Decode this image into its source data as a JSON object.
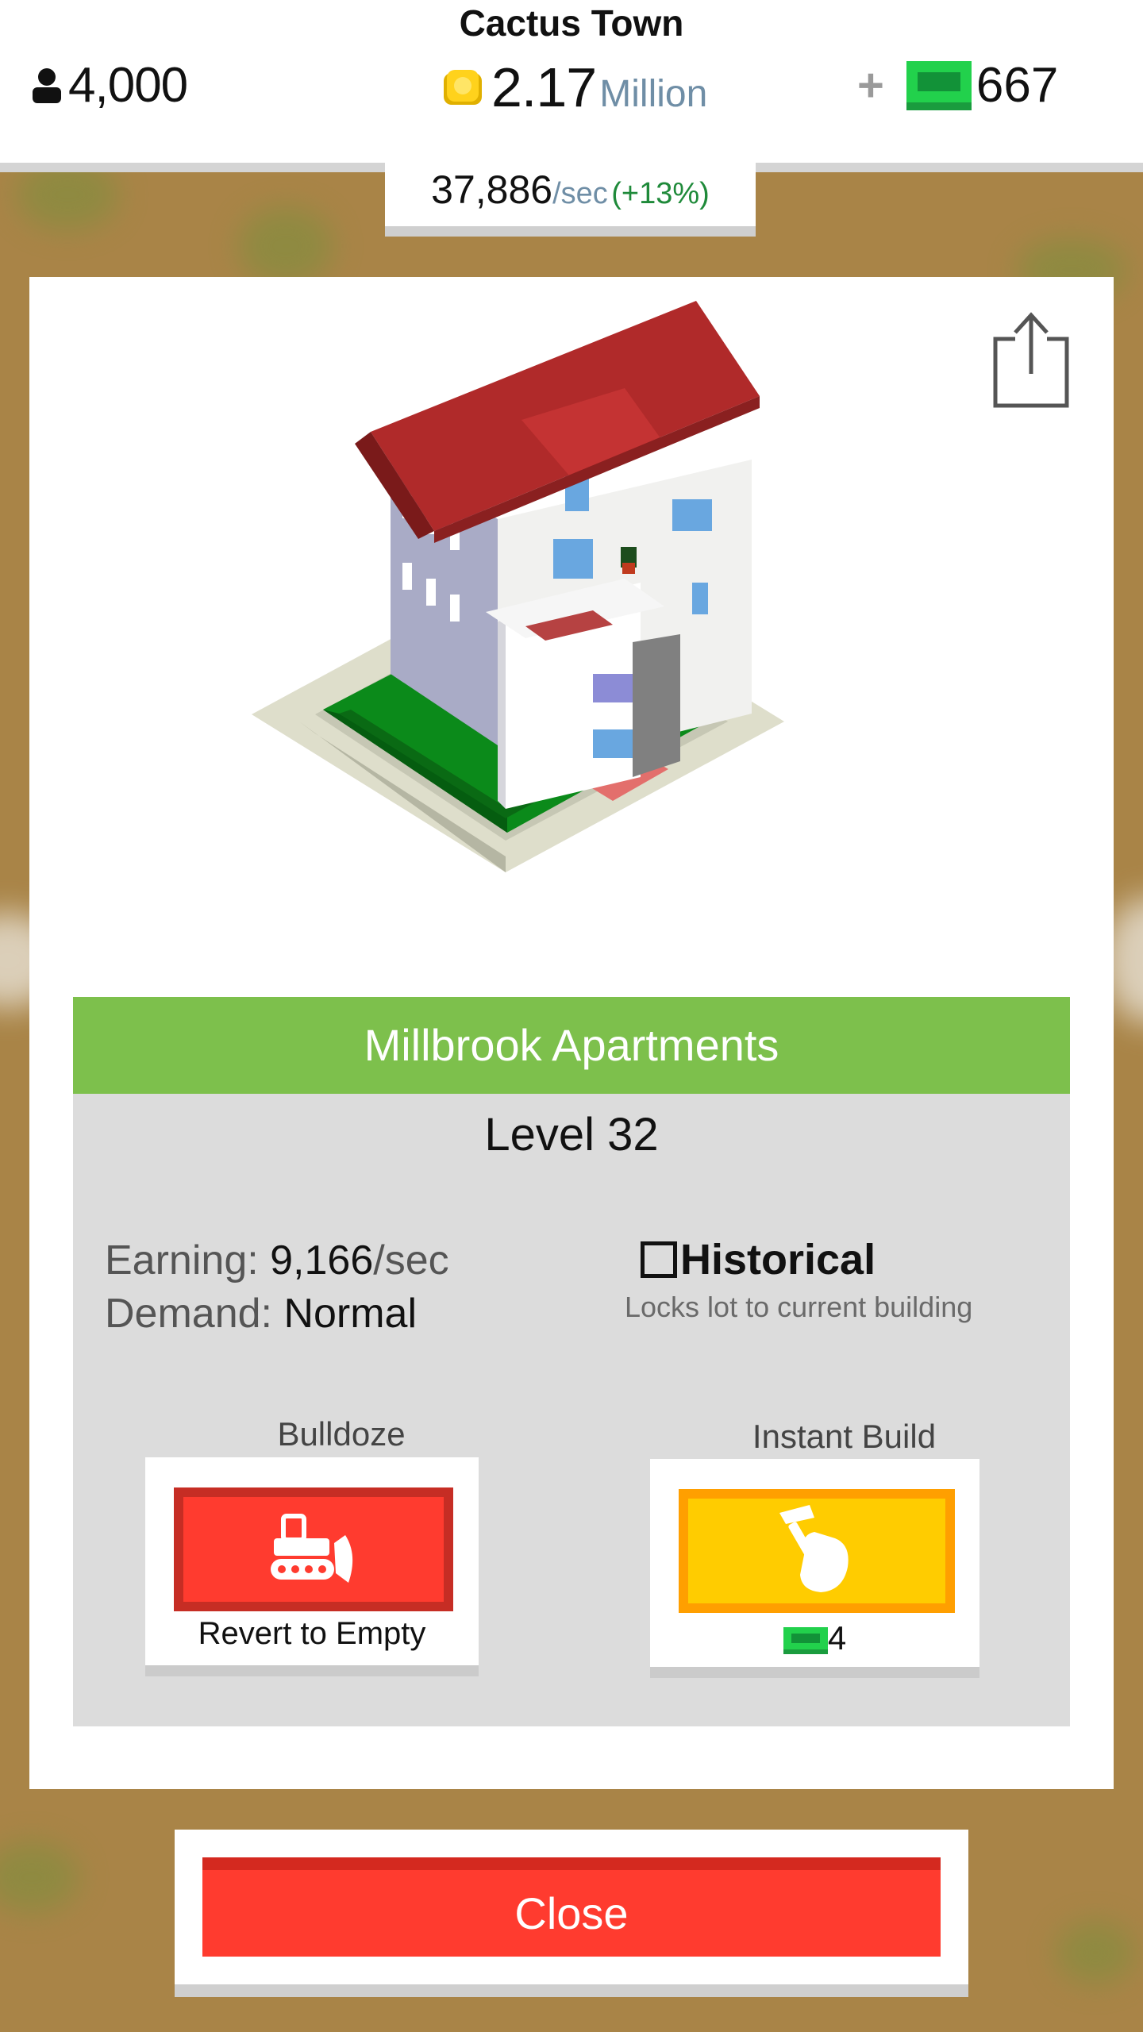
{
  "header": {
    "town_name": "Cactus Town",
    "population": "4,000",
    "coins_value": "2.17",
    "coins_unit": "Million",
    "plus_label": "+",
    "cash": "667",
    "rate_value": "37,886",
    "rate_unit": "/sec",
    "rate_pct": "(+13%)"
  },
  "building": {
    "name": "Millbrook Apartments",
    "level": "Level 32",
    "earning_label": "Earning:",
    "earning_value": "9,166",
    "earning_unit": "/sec",
    "demand_label": "Demand:",
    "demand_value": "Normal",
    "historical_label": "Historical",
    "historical_desc": "Locks lot to current building",
    "historical_checked": false
  },
  "actions": {
    "bulldoze_title": "Bulldoze",
    "bulldoze_button": "Revert to Empty",
    "instant_title": "Instant Build",
    "instant_cost": "4"
  },
  "footer": {
    "close_label": "Close"
  },
  "colors": {
    "accent_green": "#7dc04c",
    "bulldoze_red": "#ff3b2f",
    "instant_yellow": "#ffcc00",
    "close_red": "#ff3b2f",
    "cash_green": "#22b14c"
  },
  "icons": {
    "population": "person-icon",
    "coins": "coin-icon",
    "cash": "cash-icon",
    "share": "share-icon",
    "bulldoze": "bulldozer-icon",
    "instant": "hammer-hand-icon"
  }
}
